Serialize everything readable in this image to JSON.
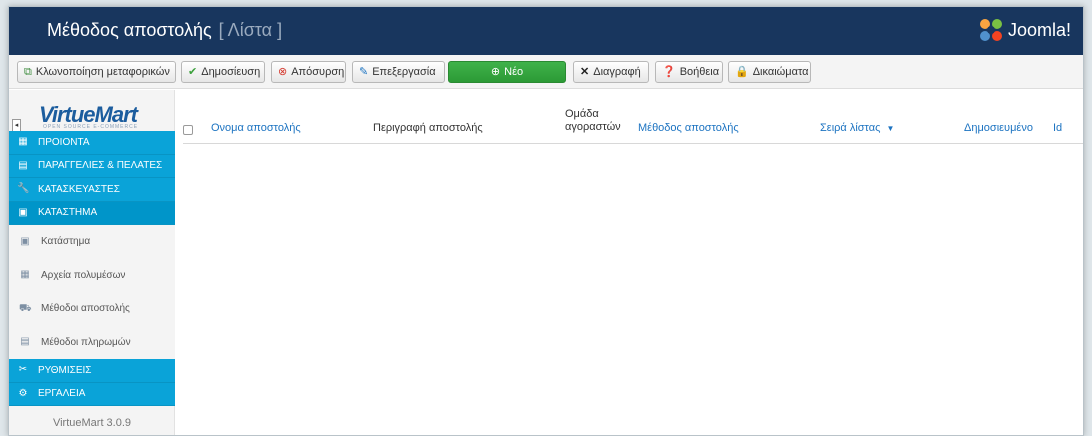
{
  "header": {
    "title": "Μέθοδος αποστολής",
    "subtitle": "[ Λίστα ]",
    "brand": "Joomla!"
  },
  "toolbar": {
    "clone": "Κλωνοποίηση μεταφορικών",
    "publish": "Δημοσίευση",
    "unpublish": "Απόσυρση",
    "edit": "Επεξεργασία",
    "new": "Νέο",
    "delete": "Διαγραφή",
    "help": "Βοήθεια",
    "permissions": "Δικαιώματα"
  },
  "sidebar": {
    "logo": "VirtueMart",
    "logo_sub": "OPEN SOURCE E-COMMERCE",
    "menu": [
      {
        "label": "ΠΡΟΙΟΝΤΑ",
        "icon": "products-icon"
      },
      {
        "label": "ΠΑΡΑΓΓΕΛΙΕΣ & ΠΕΛΑΤΕΣ",
        "icon": "orders-icon"
      },
      {
        "label": "ΚΑΤΑΣΚΕΥΑΣΤΕΣ",
        "icon": "manufacturers-icon"
      },
      {
        "label": "ΚΑΤΑΣΤΗΜΑ",
        "icon": "store-icon"
      }
    ],
    "submenu": [
      {
        "label": "Κατάστημα",
        "icon": "store-icon"
      },
      {
        "label": "Αρχεία πολυμέσων",
        "icon": "media-icon"
      },
      {
        "label": "Μέθοδοι αποστολής",
        "icon": "truck-icon"
      },
      {
        "label": "Μέθοδοι πληρωμών",
        "icon": "payment-icon"
      }
    ],
    "menu2": [
      {
        "label": "ΡΥΘΜΙΣΕΙΣ",
        "icon": "settings-icon"
      },
      {
        "label": "ΕΡΓΑΛΕΙΑ",
        "icon": "tools-icon"
      }
    ],
    "version": "VirtueMart 3.0.9"
  },
  "table": {
    "columns": {
      "name": "Ονομα αποστολής",
      "description": "Περιγραφή αποστολής",
      "group_line1": "Ομάδα",
      "group_line2": "αγοραστών",
      "method": "Μέθοδος αποστολής",
      "order": "Σειρά λίστας",
      "published": "Δημοσιευμένο",
      "id": "Id"
    },
    "rows": []
  },
  "colors": {
    "header_bg": "#18365e",
    "menu_bg": "#0aa3d8",
    "new_button": "#3fb24a",
    "link": "#1c73c1"
  }
}
